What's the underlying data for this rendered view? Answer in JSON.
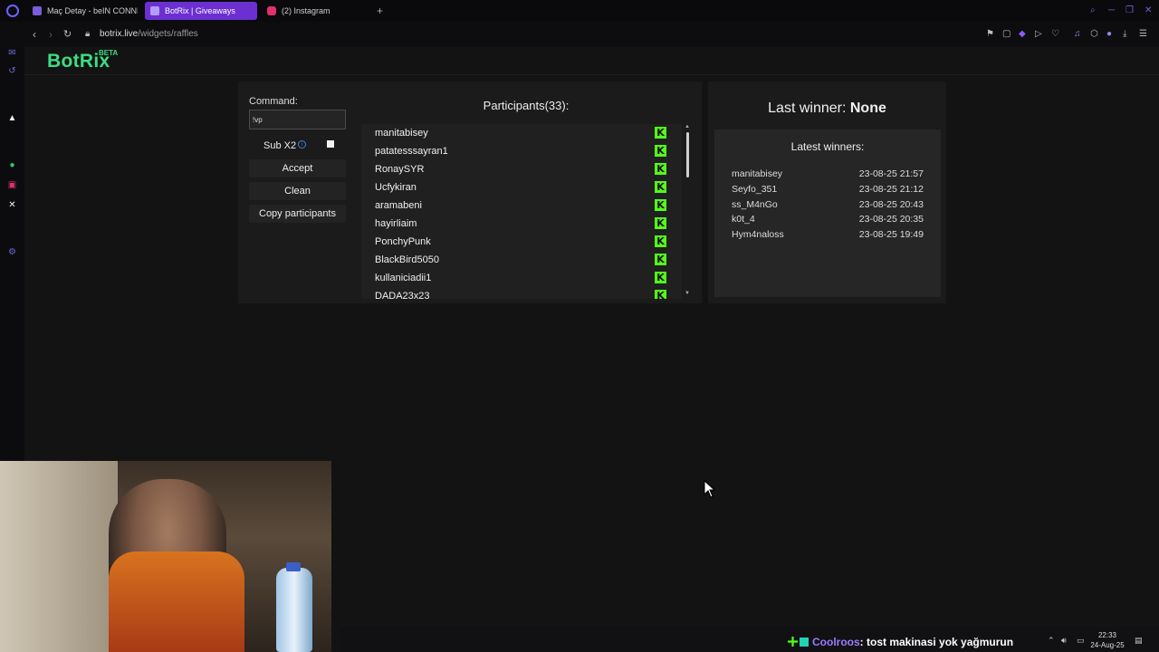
{
  "browser": {
    "tabs": [
      {
        "label": "Maç Detay - beIN CONNE",
        "color": "#7b5cd6"
      },
      {
        "label": "BotRix | Giveaways",
        "color": "#b39bff"
      },
      {
        "label": "(2) Instagram",
        "color": "#e1306c"
      }
    ],
    "new_tab": "+",
    "url_domain": "botrix.live",
    "url_path": "/widgets/raffles"
  },
  "app": {
    "logo": "BotRix",
    "beta": "BETA"
  },
  "raffle": {
    "command_label": "Command:",
    "command_value": "!vp",
    "sub_label": "Sub X2",
    "info_glyph": "i",
    "accept_label": "Accept",
    "clean_label": "Clean",
    "copy_label": "Copy participants",
    "participants_title": "Participants(33):",
    "participants": [
      "manitabisey",
      "patatesssayran1",
      "RonaySYR",
      "Ucfykiran",
      "aramabeni",
      "hayirliaim",
      "PonchyPunk",
      "BlackBird5050",
      "kullaniciadii1",
      "DADA23x23"
    ],
    "platform_glyph": "K",
    "platform_color": "#53fc18"
  },
  "winners": {
    "last_winner_label": "Last winner:",
    "last_winner_value": "None",
    "latest_title": "Latest winners:",
    "rows": [
      {
        "name": "manitabisey",
        "date": "23-08-25 21:57"
      },
      {
        "name": "Seyfo_351",
        "date": "23-08-25 21:12"
      },
      {
        "name": "ss_M4nGo",
        "date": "23-08-25 20:43"
      },
      {
        "name": "k0t_4",
        "date": "23-08-25 20:35"
      },
      {
        "name": "Hym4naloss",
        "date": "23-08-25 19:49"
      }
    ]
  },
  "chat": {
    "user": "Coolroos",
    "message": ": tost makinasi yok yağmurun"
  },
  "clock": {
    "time": "22:33",
    "date": "24-Aug-25"
  },
  "colors": {
    "accent": "#6c2fd1",
    "brand_green": "#3ddc84"
  }
}
